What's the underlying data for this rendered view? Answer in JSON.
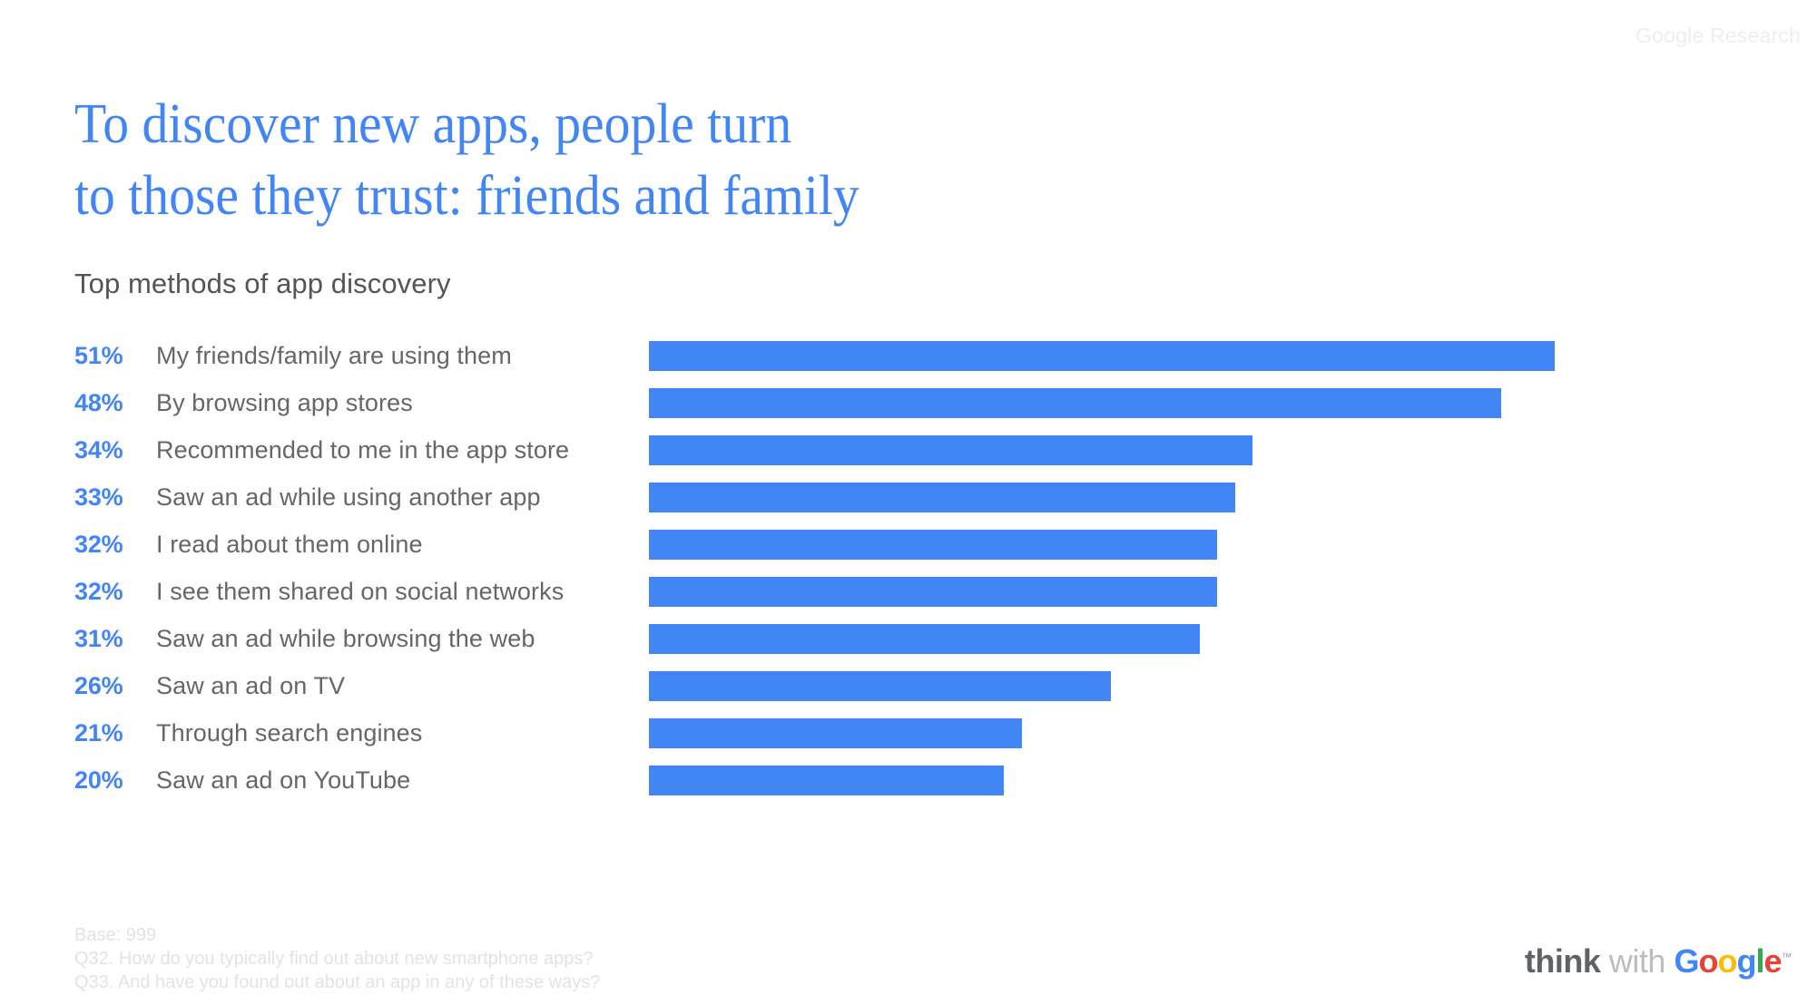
{
  "watermark": "Google Research",
  "title": {
    "line1": "To discover new apps, people turn",
    "line2": "to those they trust: friends and family",
    "color": "#4285F4"
  },
  "subtitle": "Top methods of app discovery",
  "footnotes": {
    "base": "Base: 999",
    "q32": "Q32. How do you typically find out about new smartphone apps?",
    "q33": "Q33. And have you found out about an app in any of these ways?"
  },
  "branding": {
    "think": "think",
    "with": "with",
    "google": {
      "g": "G",
      "o1": "o",
      "o2": "o",
      "g2": "g",
      "l": "l",
      "e": "e",
      "tm": "™"
    }
  },
  "chart_data": {
    "type": "bar",
    "orientation": "horizontal",
    "title": "Top methods of app discovery",
    "xlabel": "",
    "ylabel": "",
    "xlim": [
      0,
      51
    ],
    "grid": false,
    "legend": null,
    "value_suffix": "%",
    "bar_color": "#4285F4",
    "value_label_color": "#4285F4",
    "category_label_color": "#666666",
    "categories": [
      "My friends/family are using them",
      "By browsing app stores",
      "Recommended to me in the app store",
      "Saw an ad while using another app",
      "I read about them online",
      "I see them shared on social networks",
      "Saw an ad while browsing the web",
      "Saw an ad on TV",
      "Through search engines",
      "Saw an ad on YouTube"
    ],
    "values": [
      51,
      48,
      34,
      33,
      32,
      32,
      31,
      26,
      21,
      20
    ],
    "value_labels": [
      "51%",
      "48%",
      "34%",
      "33%",
      "32%",
      "32%",
      "31%",
      "26%",
      "21%",
      "20%"
    ],
    "rows": [
      {
        "value_label": "51%",
        "value": 51,
        "category": "My friends/family are using them"
      },
      {
        "value_label": "48%",
        "value": 48,
        "category": "By browsing app stores"
      },
      {
        "value_label": "34%",
        "value": 34,
        "category": "Recommended to me in the app store"
      },
      {
        "value_label": "33%",
        "value": 33,
        "category": "Saw an ad while using another app"
      },
      {
        "value_label": "32%",
        "value": 32,
        "category": "I read about them online"
      },
      {
        "value_label": "32%",
        "value": 32,
        "category": "I see them shared on social networks"
      },
      {
        "value_label": "31%",
        "value": 31,
        "category": "Saw an ad while browsing the web"
      },
      {
        "value_label": "26%",
        "value": 26,
        "category": "Saw an ad on TV"
      },
      {
        "value_label": "21%",
        "value": 21,
        "category": "Through search engines"
      },
      {
        "value_label": "20%",
        "value": 20,
        "category": "Saw an ad on YouTube"
      }
    ]
  }
}
